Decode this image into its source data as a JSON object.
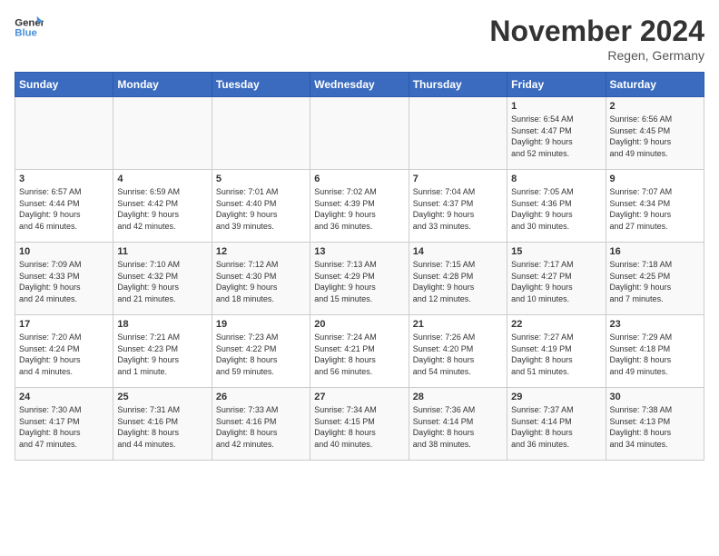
{
  "logo": {
    "line1": "General",
    "line2": "Blue"
  },
  "title": "November 2024",
  "location": "Regen, Germany",
  "days_header": [
    "Sunday",
    "Monday",
    "Tuesday",
    "Wednesday",
    "Thursday",
    "Friday",
    "Saturday"
  ],
  "weeks": [
    [
      {
        "day": "",
        "info": ""
      },
      {
        "day": "",
        "info": ""
      },
      {
        "day": "",
        "info": ""
      },
      {
        "day": "",
        "info": ""
      },
      {
        "day": "",
        "info": ""
      },
      {
        "day": "1",
        "info": "Sunrise: 6:54 AM\nSunset: 4:47 PM\nDaylight: 9 hours\nand 52 minutes."
      },
      {
        "day": "2",
        "info": "Sunrise: 6:56 AM\nSunset: 4:45 PM\nDaylight: 9 hours\nand 49 minutes."
      }
    ],
    [
      {
        "day": "3",
        "info": "Sunrise: 6:57 AM\nSunset: 4:44 PM\nDaylight: 9 hours\nand 46 minutes."
      },
      {
        "day": "4",
        "info": "Sunrise: 6:59 AM\nSunset: 4:42 PM\nDaylight: 9 hours\nand 42 minutes."
      },
      {
        "day": "5",
        "info": "Sunrise: 7:01 AM\nSunset: 4:40 PM\nDaylight: 9 hours\nand 39 minutes."
      },
      {
        "day": "6",
        "info": "Sunrise: 7:02 AM\nSunset: 4:39 PM\nDaylight: 9 hours\nand 36 minutes."
      },
      {
        "day": "7",
        "info": "Sunrise: 7:04 AM\nSunset: 4:37 PM\nDaylight: 9 hours\nand 33 minutes."
      },
      {
        "day": "8",
        "info": "Sunrise: 7:05 AM\nSunset: 4:36 PM\nDaylight: 9 hours\nand 30 minutes."
      },
      {
        "day": "9",
        "info": "Sunrise: 7:07 AM\nSunset: 4:34 PM\nDaylight: 9 hours\nand 27 minutes."
      }
    ],
    [
      {
        "day": "10",
        "info": "Sunrise: 7:09 AM\nSunset: 4:33 PM\nDaylight: 9 hours\nand 24 minutes."
      },
      {
        "day": "11",
        "info": "Sunrise: 7:10 AM\nSunset: 4:32 PM\nDaylight: 9 hours\nand 21 minutes."
      },
      {
        "day": "12",
        "info": "Sunrise: 7:12 AM\nSunset: 4:30 PM\nDaylight: 9 hours\nand 18 minutes."
      },
      {
        "day": "13",
        "info": "Sunrise: 7:13 AM\nSunset: 4:29 PM\nDaylight: 9 hours\nand 15 minutes."
      },
      {
        "day": "14",
        "info": "Sunrise: 7:15 AM\nSunset: 4:28 PM\nDaylight: 9 hours\nand 12 minutes."
      },
      {
        "day": "15",
        "info": "Sunrise: 7:17 AM\nSunset: 4:27 PM\nDaylight: 9 hours\nand 10 minutes."
      },
      {
        "day": "16",
        "info": "Sunrise: 7:18 AM\nSunset: 4:25 PM\nDaylight: 9 hours\nand 7 minutes."
      }
    ],
    [
      {
        "day": "17",
        "info": "Sunrise: 7:20 AM\nSunset: 4:24 PM\nDaylight: 9 hours\nand 4 minutes."
      },
      {
        "day": "18",
        "info": "Sunrise: 7:21 AM\nSunset: 4:23 PM\nDaylight: 9 hours\nand 1 minute."
      },
      {
        "day": "19",
        "info": "Sunrise: 7:23 AM\nSunset: 4:22 PM\nDaylight: 8 hours\nand 59 minutes."
      },
      {
        "day": "20",
        "info": "Sunrise: 7:24 AM\nSunset: 4:21 PM\nDaylight: 8 hours\nand 56 minutes."
      },
      {
        "day": "21",
        "info": "Sunrise: 7:26 AM\nSunset: 4:20 PM\nDaylight: 8 hours\nand 54 minutes."
      },
      {
        "day": "22",
        "info": "Sunrise: 7:27 AM\nSunset: 4:19 PM\nDaylight: 8 hours\nand 51 minutes."
      },
      {
        "day": "23",
        "info": "Sunrise: 7:29 AM\nSunset: 4:18 PM\nDaylight: 8 hours\nand 49 minutes."
      }
    ],
    [
      {
        "day": "24",
        "info": "Sunrise: 7:30 AM\nSunset: 4:17 PM\nDaylight: 8 hours\nand 47 minutes."
      },
      {
        "day": "25",
        "info": "Sunrise: 7:31 AM\nSunset: 4:16 PM\nDaylight: 8 hours\nand 44 minutes."
      },
      {
        "day": "26",
        "info": "Sunrise: 7:33 AM\nSunset: 4:16 PM\nDaylight: 8 hours\nand 42 minutes."
      },
      {
        "day": "27",
        "info": "Sunrise: 7:34 AM\nSunset: 4:15 PM\nDaylight: 8 hours\nand 40 minutes."
      },
      {
        "day": "28",
        "info": "Sunrise: 7:36 AM\nSunset: 4:14 PM\nDaylight: 8 hours\nand 38 minutes."
      },
      {
        "day": "29",
        "info": "Sunrise: 7:37 AM\nSunset: 4:14 PM\nDaylight: 8 hours\nand 36 minutes."
      },
      {
        "day": "30",
        "info": "Sunrise: 7:38 AM\nSunset: 4:13 PM\nDaylight: 8 hours\nand 34 minutes."
      }
    ]
  ]
}
